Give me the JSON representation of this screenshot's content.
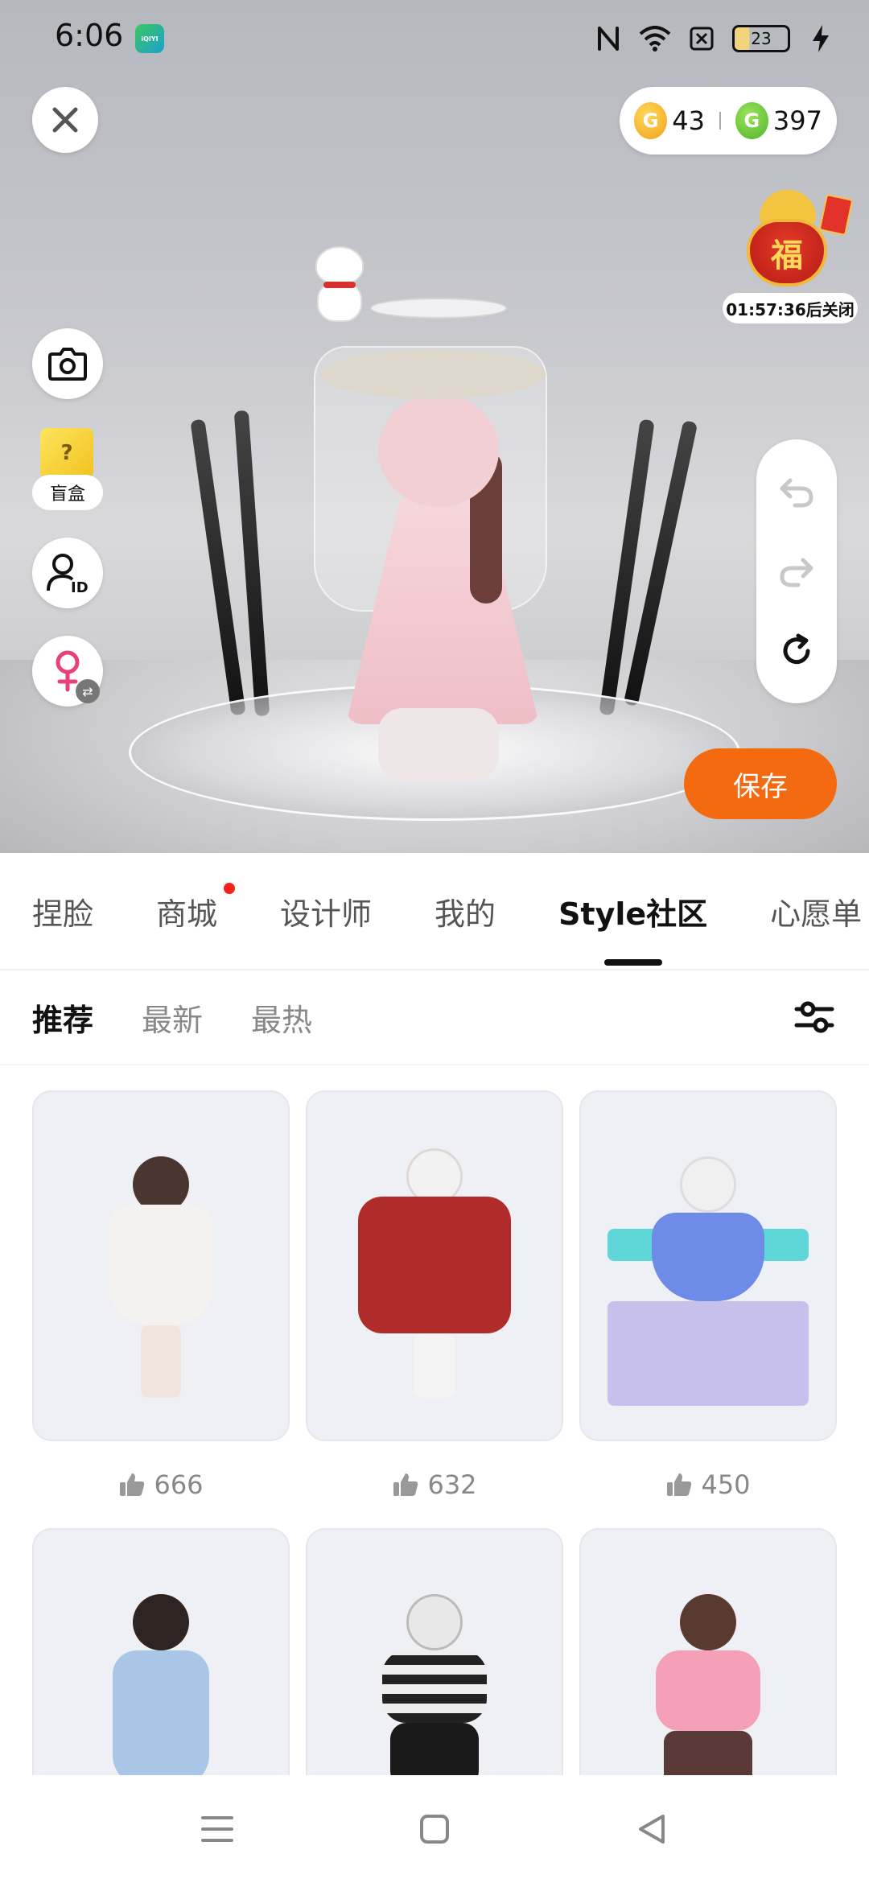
{
  "status_bar": {
    "time": "6:06",
    "app_badge": "iQIYI\n奇异果",
    "battery": "23"
  },
  "currency": {
    "gold_amount": "43",
    "green_amount": "397",
    "gold_symbol": "G",
    "green_symbol": "G"
  },
  "lucky_bag": {
    "char": "福",
    "timer": "01:57:36后关闭"
  },
  "left_tools": {
    "blind_box_label": "盲盒",
    "blind_box_mark": "?"
  },
  "save_label": "保存",
  "tabs": [
    {
      "label": "捏脸"
    },
    {
      "label": "商城"
    },
    {
      "label": "设计师"
    },
    {
      "label": "我的"
    },
    {
      "label": "Style社区"
    },
    {
      "label": "心愿单"
    }
  ],
  "subtabs": [
    {
      "label": "推荐"
    },
    {
      "label": "最新"
    },
    {
      "label": "最热"
    }
  ],
  "cards": [
    {
      "likes": "666"
    },
    {
      "likes": "632"
    },
    {
      "likes": "450"
    },
    {
      "likes": ""
    },
    {
      "likes": ""
    },
    {
      "likes": ""
    }
  ],
  "colors": {
    "accent": "#f36a10",
    "tab_dot": "#f0241b"
  }
}
